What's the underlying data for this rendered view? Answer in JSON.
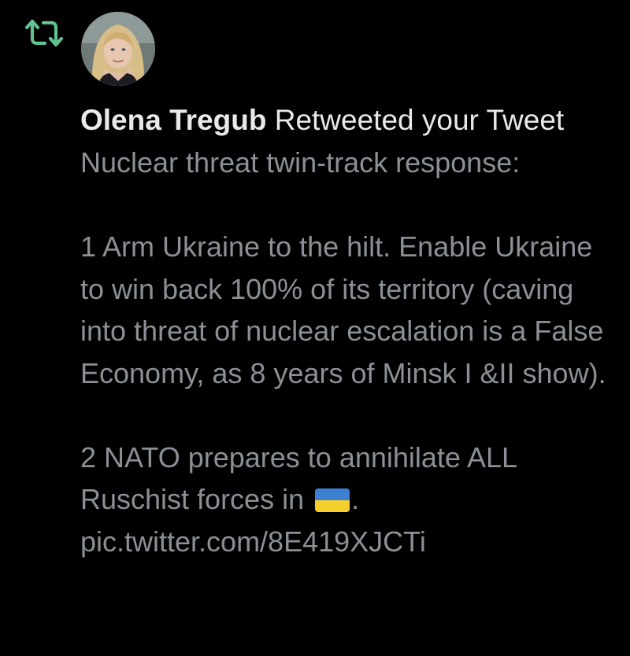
{
  "notification": {
    "type_icon": "retweet-icon",
    "accent_color": "#5fc290",
    "user_name": "Olena Tregub",
    "action_text": " Retweeted your Tweet",
    "tweet": {
      "line_1": "Nuclear threat twin-track response:",
      "paragraph_1": "1 Arm Ukraine to the hilt. Enable Ukraine to win back 100% of its territory (caving into threat of nuclear escalation is a False Economy, as 8 years of Minsk I &II show).",
      "paragraph_2_before_flag": "2 NATO prepares to annihilate ALL Ruschist forces in ",
      "flag": {
        "name": "ukraine-flag-emoji",
        "top_color": "#3d7fd1",
        "bottom_color": "#f4cf2c"
      },
      "paragraph_2_after_flag": ".",
      "link": "pic.twitter.com/8E419XJCTi"
    }
  }
}
